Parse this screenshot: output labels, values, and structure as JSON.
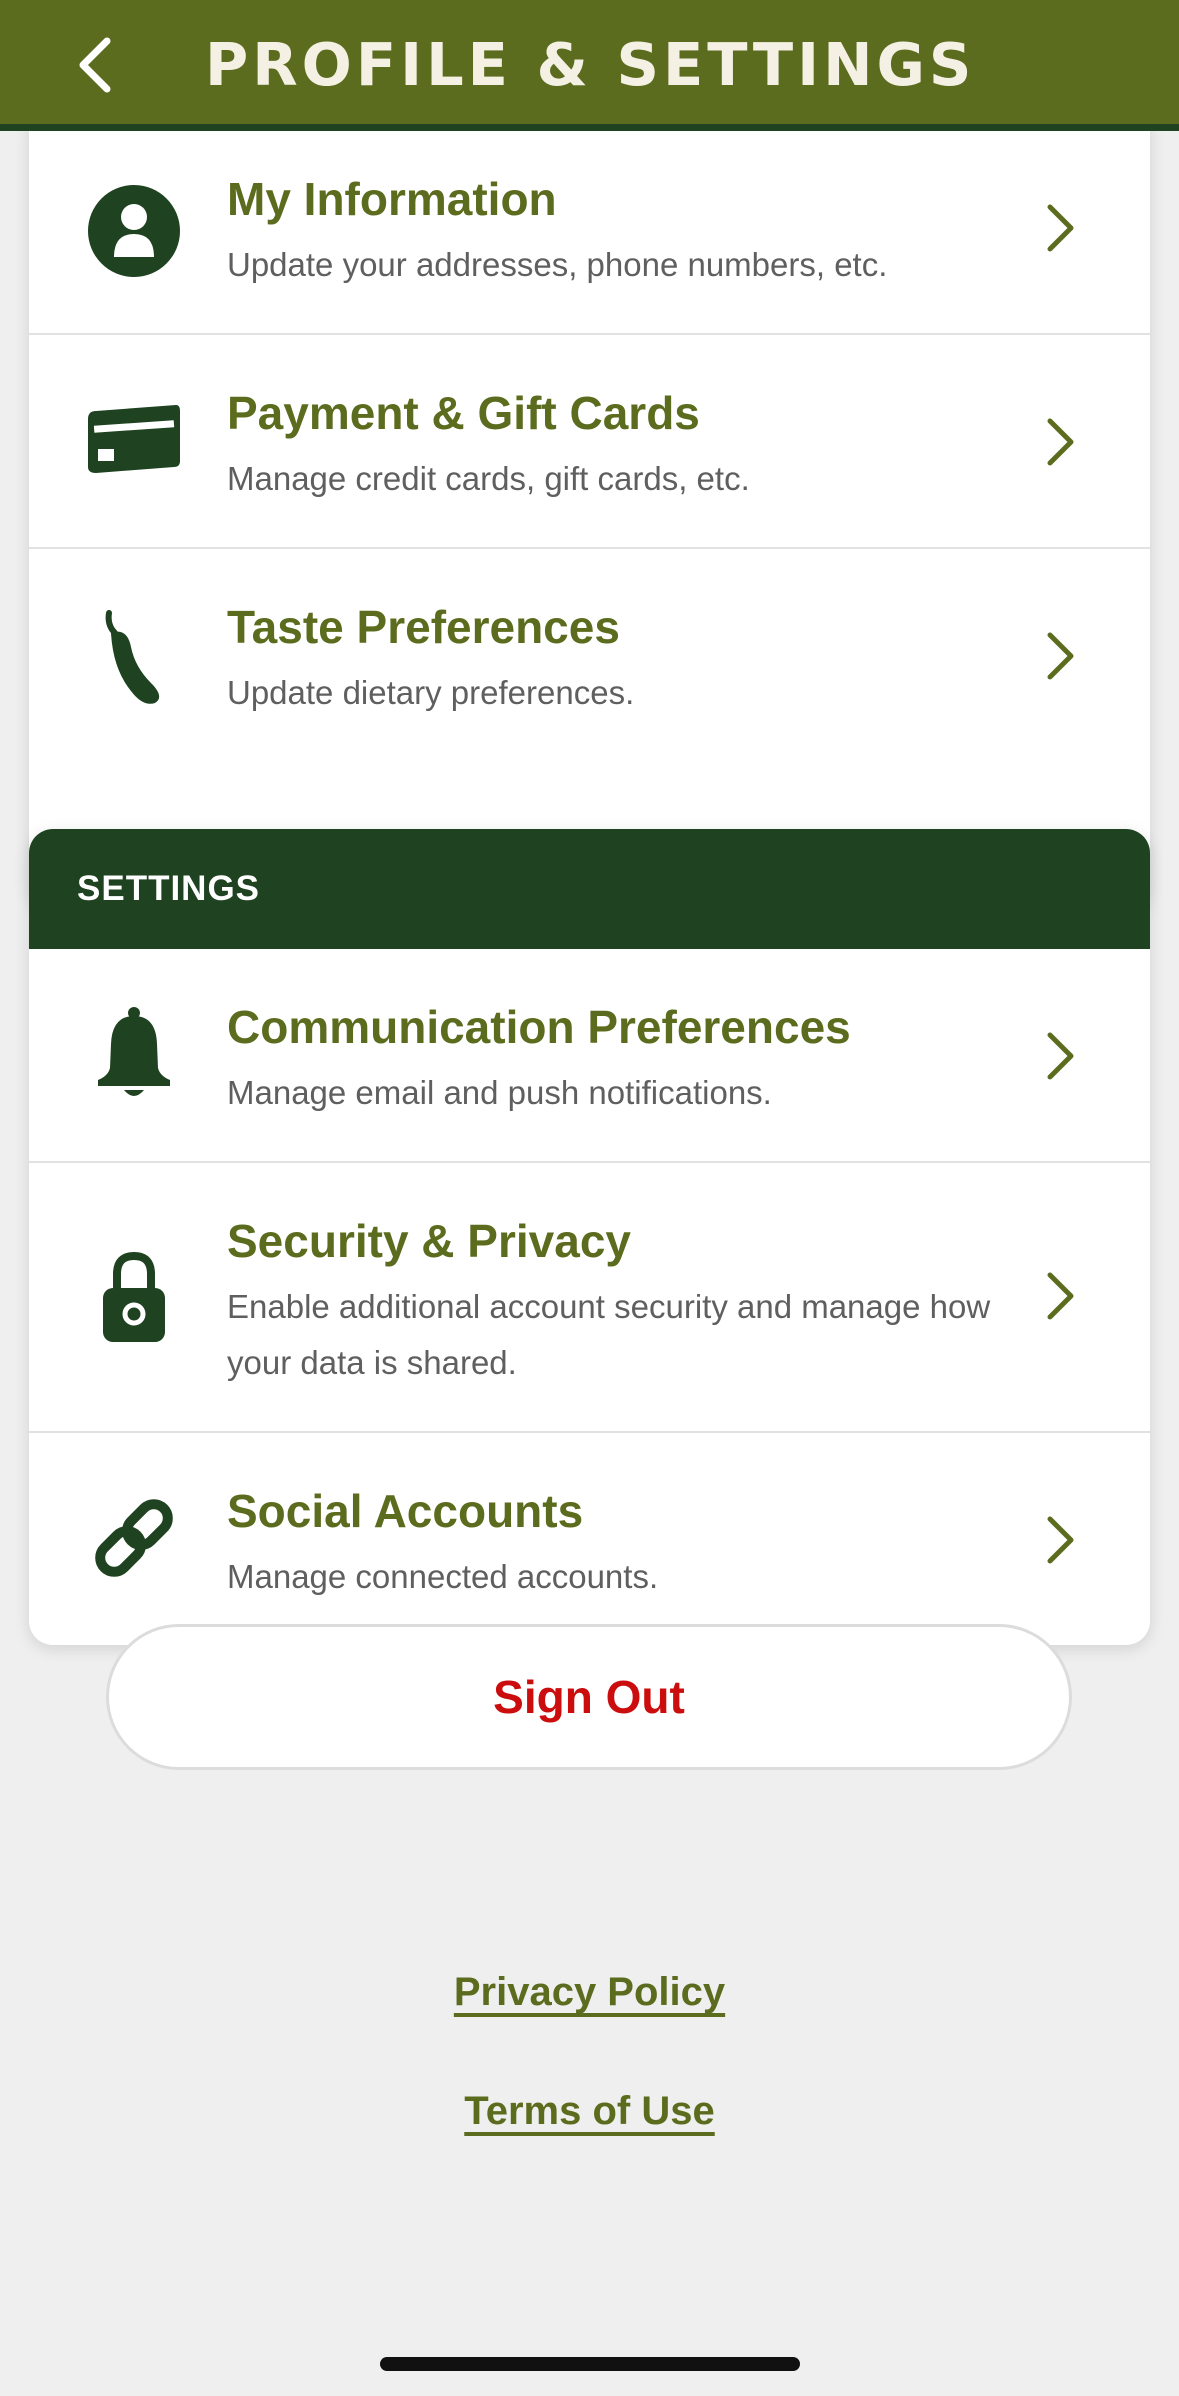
{
  "header": {
    "title": "PROFILE & SETTINGS",
    "back_icon": "chevron-left-icon",
    "background": "#5c6c1e"
  },
  "account": {
    "items": [
      {
        "title": "My Information",
        "description": "Update your addresses, phone numbers, etc.",
        "icon": "person-icon"
      },
      {
        "title": "Payment & Gift Cards",
        "description": "Manage credit cards, gift cards, etc.",
        "icon": "credit-card-icon"
      },
      {
        "title": "Taste Preferences",
        "description": "Update dietary preferences.",
        "icon": "pepper-icon"
      }
    ]
  },
  "settings": {
    "heading": "SETTINGS",
    "items": [
      {
        "title": "Communication Preferences",
        "description": "Manage email and push notifications.",
        "icon": "bell-icon"
      },
      {
        "title": "Security & Privacy",
        "description": "Enable additional account security and manage how your data is shared.",
        "icon": "lock-icon"
      },
      {
        "title": "Social Accounts",
        "description": "Manage connected accounts.",
        "icon": "link-icon"
      }
    ]
  },
  "sign_out_label": "Sign Out",
  "links": {
    "privacy": "Privacy Policy",
    "terms": "Terms of Use"
  },
  "colors": {
    "accent_olive": "#5c6c1e",
    "dark_green": "#1f4220",
    "sign_out_red": "#cc0d0d"
  }
}
